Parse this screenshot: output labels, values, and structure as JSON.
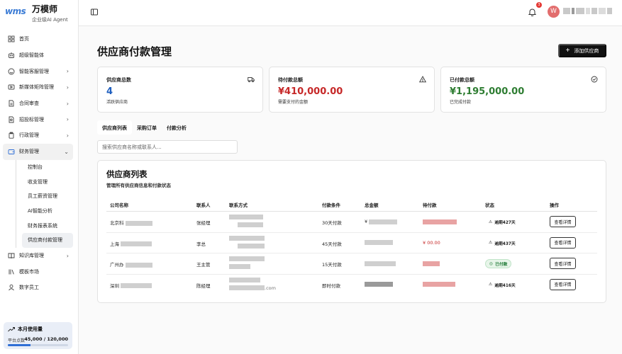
{
  "brand": {
    "logo": "wms",
    "name": "万模师",
    "subtitle": "企业级AI Agent"
  },
  "nav": {
    "items": [
      {
        "label": "首页",
        "icon": "grid-icon"
      },
      {
        "label": "超级智能体",
        "icon": "bot-icon"
      },
      {
        "label": "智能客服管理",
        "icon": "headset-icon",
        "has_children": true
      },
      {
        "label": "新媒体矩阵管理",
        "icon": "media-icon",
        "has_children": true
      },
      {
        "label": "合同审查",
        "icon": "document-icon",
        "has_children": true
      },
      {
        "label": "招投标管理",
        "icon": "file-search-icon",
        "has_children": true
      },
      {
        "label": "行政管理",
        "icon": "clipboard-icon",
        "has_children": true
      },
      {
        "label": "财务管理",
        "icon": "wallet-icon",
        "has_children": true,
        "expanded": true
      }
    ],
    "finance_children": [
      "控制台",
      "收支管理",
      "员工薪资管理",
      "AI智能分析",
      "财务报表系统",
      "供应商付款管理"
    ],
    "bottom_items": [
      {
        "label": "知识库管理",
        "icon": "book-icon",
        "has_children": true
      },
      {
        "label": "模板市场",
        "icon": "library-icon"
      },
      {
        "label": "数字员工",
        "icon": "users-icon"
      }
    ]
  },
  "usage": {
    "title": "本月使用量",
    "label": "平台点数",
    "value": "45,000 / 120,000",
    "fraction": 0.375
  },
  "topbar": {
    "notification_count": "3",
    "avatar_letter": "W"
  },
  "page": {
    "title": "供应商付款管理",
    "add_button": "添加供应商"
  },
  "cards": [
    {
      "label": "供应商总数",
      "value": "4",
      "note": "活跃供应商",
      "color": "#1f5fbf",
      "icon": "truck-icon"
    },
    {
      "label": "待付款总额",
      "value": "¥410,000.00",
      "note": "需要支付的金额",
      "color": "#c62828",
      "icon": "warning-icon"
    },
    {
      "label": "已付款总额",
      "value": "¥1,195,000.00",
      "note": "已完成付款",
      "color": "#2e7d32",
      "icon": "check-circle-icon"
    }
  ],
  "tabs": [
    "供应商列表",
    "采购订单",
    "付款分析"
  ],
  "search": {
    "placeholder": "搜索供应商名称或联系人..."
  },
  "table": {
    "title": "供应商列表",
    "subtitle": "管理所有供应商信息和付款状态",
    "headers": [
      "公司名称",
      "联系人",
      "联系方式",
      "付款条件",
      "总金额",
      "待付款",
      "状态",
      "操作"
    ],
    "rows": [
      {
        "company_prefix": "北京科",
        "contact": "张经理",
        "terms": "30天付款",
        "total_prefix": "¥",
        "pending_suffix": "",
        "status": "逾期427天",
        "status_type": "overdue",
        "action": "查看详情"
      },
      {
        "company_prefix": "上海",
        "contact": "李总",
        "terms": "45天付款",
        "total_prefix": "",
        "pending_suffix": "¥ 00.00",
        "status": "逾期437天",
        "status_type": "overdue",
        "action": "查看详情"
      },
      {
        "company_prefix": "广州办",
        "contact": "王主管",
        "terms": "15天付款",
        "total_prefix": "",
        "pending_suffix": "",
        "status": "已付款",
        "status_type": "paid",
        "action": "查看详情"
      },
      {
        "company_prefix": "深圳",
        "contact": "陈经理",
        "terms": "即时付款",
        "total_prefix": "",
        "pending_suffix": "",
        "status": "逾期416天",
        "status_type": "overdue",
        "action": "查看详情"
      }
    ],
    "contact_suffix_last": "com"
  }
}
